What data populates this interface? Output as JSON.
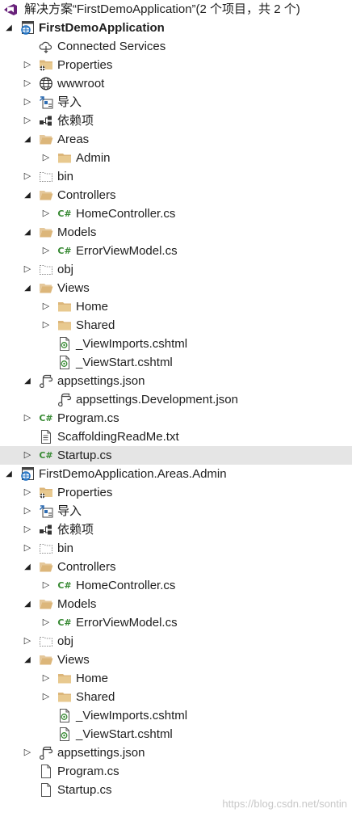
{
  "solution_explorer": {
    "rows": [
      {
        "depth": 0,
        "arrow": "none",
        "icon": "solution-icon",
        "label": "解决方案“FirstDemoApplication”(2 个项目，共 2 个)",
        "bold": false
      },
      {
        "depth": 0,
        "arrow": "expanded",
        "icon": "web-project-icon",
        "label": "FirstDemoApplication",
        "bold": true
      },
      {
        "depth": 1,
        "arrow": "none",
        "icon": "connected-services-icon",
        "label": "Connected Services"
      },
      {
        "depth": 1,
        "arrow": "collapsed",
        "icon": "properties-folder-icon",
        "label": "Properties"
      },
      {
        "depth": 1,
        "arrow": "collapsed",
        "icon": "globe-icon",
        "label": "wwwroot"
      },
      {
        "depth": 1,
        "arrow": "collapsed",
        "icon": "import-icon",
        "label": "导入"
      },
      {
        "depth": 1,
        "arrow": "collapsed",
        "icon": "dependencies-icon",
        "label": "依赖项"
      },
      {
        "depth": 1,
        "arrow": "expanded",
        "icon": "folder-open-icon",
        "label": "Areas"
      },
      {
        "depth": 2,
        "arrow": "collapsed",
        "icon": "folder-icon",
        "label": "Admin"
      },
      {
        "depth": 1,
        "arrow": "collapsed",
        "icon": "folder-dotted-icon",
        "label": "bin"
      },
      {
        "depth": 1,
        "arrow": "expanded",
        "icon": "folder-open-icon",
        "label": "Controllers"
      },
      {
        "depth": 2,
        "arrow": "collapsed",
        "icon": "csharp-file-icon",
        "label": "HomeController.cs"
      },
      {
        "depth": 1,
        "arrow": "expanded",
        "icon": "folder-open-icon",
        "label": "Models"
      },
      {
        "depth": 2,
        "arrow": "collapsed",
        "icon": "csharp-file-icon",
        "label": "ErrorViewModel.cs"
      },
      {
        "depth": 1,
        "arrow": "collapsed",
        "icon": "folder-dotted-icon",
        "label": "obj"
      },
      {
        "depth": 1,
        "arrow": "expanded",
        "icon": "folder-open-icon",
        "label": "Views"
      },
      {
        "depth": 2,
        "arrow": "collapsed",
        "icon": "folder-icon",
        "label": "Home"
      },
      {
        "depth": 2,
        "arrow": "collapsed",
        "icon": "folder-icon",
        "label": "Shared"
      },
      {
        "depth": 2,
        "arrow": "none",
        "icon": "razor-file-icon",
        "label": "_ViewImports.cshtml"
      },
      {
        "depth": 2,
        "arrow": "none",
        "icon": "razor-file-icon",
        "label": "_ViewStart.cshtml"
      },
      {
        "depth": 1,
        "arrow": "expanded",
        "icon": "json-file-icon",
        "label": "appsettings.json"
      },
      {
        "depth": 2,
        "arrow": "none",
        "icon": "json-file-icon",
        "label": "appsettings.Development.json"
      },
      {
        "depth": 1,
        "arrow": "collapsed",
        "icon": "csharp-file-icon",
        "label": "Program.cs"
      },
      {
        "depth": 1,
        "arrow": "none",
        "icon": "text-file-icon",
        "label": "ScaffoldingReadMe.txt"
      },
      {
        "depth": 1,
        "arrow": "collapsed",
        "icon": "csharp-file-icon",
        "label": "Startup.cs",
        "selected": true
      },
      {
        "depth": 0,
        "arrow": "expanded",
        "icon": "web-project-icon",
        "label": "FirstDemoApplication.Areas.Admin",
        "bold": false
      },
      {
        "depth": 1,
        "arrow": "collapsed",
        "icon": "properties-folder-icon",
        "label": "Properties"
      },
      {
        "depth": 1,
        "arrow": "collapsed",
        "icon": "import-icon",
        "label": "导入"
      },
      {
        "depth": 1,
        "arrow": "collapsed",
        "icon": "dependencies-icon",
        "label": "依赖项"
      },
      {
        "depth": 1,
        "arrow": "collapsed",
        "icon": "folder-dotted-icon",
        "label": "bin"
      },
      {
        "depth": 1,
        "arrow": "expanded",
        "icon": "folder-open-icon",
        "label": "Controllers"
      },
      {
        "depth": 2,
        "arrow": "collapsed",
        "icon": "csharp-file-icon",
        "label": "HomeController.cs"
      },
      {
        "depth": 1,
        "arrow": "expanded",
        "icon": "folder-open-icon",
        "label": "Models"
      },
      {
        "depth": 2,
        "arrow": "collapsed",
        "icon": "csharp-file-icon",
        "label": "ErrorViewModel.cs"
      },
      {
        "depth": 1,
        "arrow": "collapsed",
        "icon": "folder-dotted-icon",
        "label": "obj"
      },
      {
        "depth": 1,
        "arrow": "expanded",
        "icon": "folder-open-icon",
        "label": "Views"
      },
      {
        "depth": 2,
        "arrow": "collapsed",
        "icon": "folder-icon",
        "label": "Home"
      },
      {
        "depth": 2,
        "arrow": "collapsed",
        "icon": "folder-icon",
        "label": "Shared"
      },
      {
        "depth": 2,
        "arrow": "none",
        "icon": "razor-file-icon",
        "label": "_ViewImports.cshtml"
      },
      {
        "depth": 2,
        "arrow": "none",
        "icon": "razor-file-icon",
        "label": "_ViewStart.cshtml"
      },
      {
        "depth": 1,
        "arrow": "collapsed",
        "icon": "json-file-icon",
        "label": "appsettings.json"
      },
      {
        "depth": 1,
        "arrow": "none",
        "icon": "blank-file-icon",
        "label": "Program.cs"
      },
      {
        "depth": 1,
        "arrow": "none",
        "icon": "blank-file-icon",
        "label": "Startup.cs"
      }
    ]
  },
  "watermark": "https://blog.csdn.net/sontin",
  "colors": {
    "folder": "#dcb67a",
    "csharp": "#388a34",
    "solution": "#68217a",
    "project": "#1e6fc0",
    "selected_row": "#e5e5e5"
  }
}
